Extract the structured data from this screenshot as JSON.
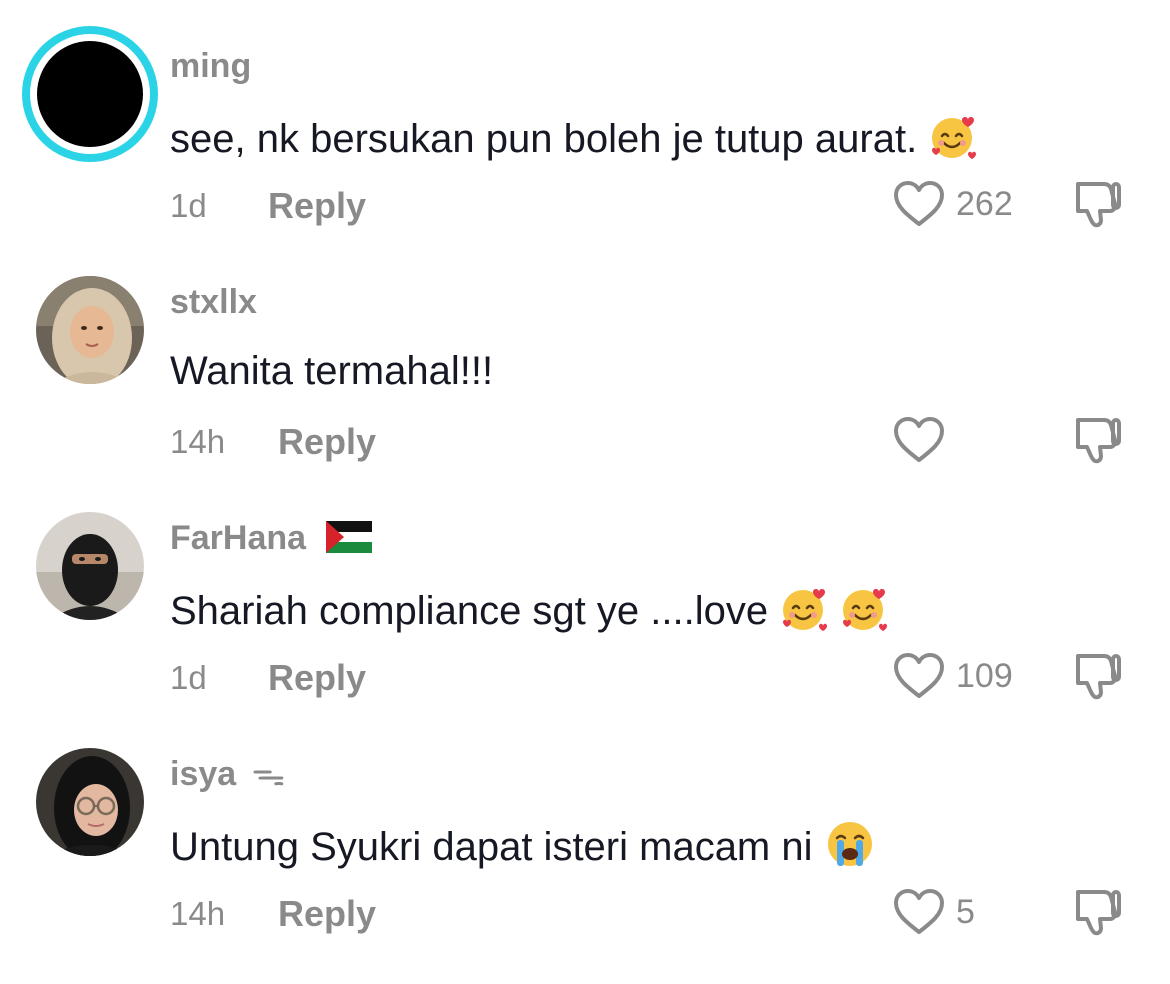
{
  "comments": [
    {
      "username": "ming",
      "text": "see, nk bersukan pun boleh je tutup aurat.",
      "time": "1d",
      "reply_label": "Reply",
      "like_count": "262",
      "avatar": "black-circle-with-teal-ring",
      "trailing_emoji": [
        "smiling-face-with-hearts"
      ]
    },
    {
      "username": "stxllx",
      "text": "Wanita termahal!!!",
      "time": "14h",
      "reply_label": "Reply",
      "like_count": "",
      "avatar": "photo-woman-beige-hijab",
      "trailing_emoji": []
    },
    {
      "username": "FarHana",
      "username_flag": "palestine-flag",
      "text": "Shariah compliance sgt ye ....love",
      "time": "1d",
      "reply_label": "Reply",
      "like_count": "109",
      "avatar": "photo-woman-black-niqab",
      "trailing_emoji": [
        "smiling-face-with-hearts",
        "smiling-face-with-hearts"
      ]
    },
    {
      "username": "isya",
      "username_suffix": "ᯓ",
      "text": "Untung Syukri dapat isteri macam ni",
      "time": "14h",
      "reply_label": "Reply",
      "like_count": "5",
      "avatar": "photo-woman-black-hijab-glasses",
      "trailing_emoji": [
        "loudly-crying-face"
      ]
    }
  ],
  "colors": {
    "ring": "#2ad4e6",
    "meta_gray": "#8a8a8a",
    "text": "#161823"
  }
}
